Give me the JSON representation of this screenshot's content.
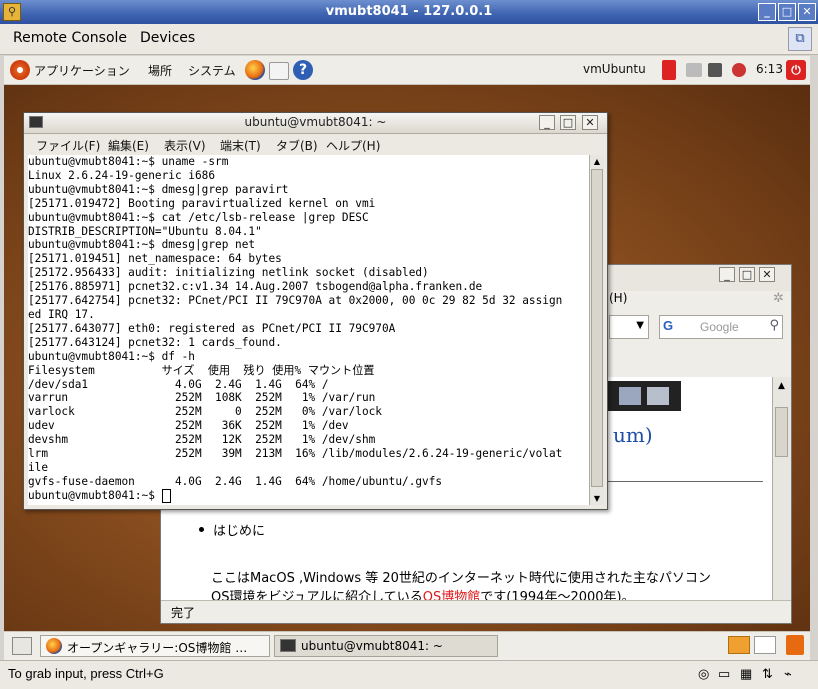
{
  "window": {
    "title": "vmubt8041 - 127.0.0.1"
  },
  "menubar": {
    "items": [
      "Remote Console",
      "Devices"
    ]
  },
  "gnome_panel": {
    "menus": [
      "アプリケーション",
      "場所",
      "システム"
    ],
    "host_label": "vmUbuntu",
    "clock": "6:13"
  },
  "terminal": {
    "title": "ubuntu@vmubt8041: ~",
    "menus": [
      "ファイル(F)",
      "編集(E)",
      "表示(V)",
      "端末(T)",
      "タブ(B)",
      "ヘルプ(H)"
    ],
    "lines": [
      "ubuntu@vmubt8041:~$ uname -srm",
      "Linux 2.6.24-19-generic i686",
      "ubuntu@vmubt8041:~$ dmesg|grep paravirt",
      "[25171.019472] Booting paravirtualized kernel on vmi",
      "ubuntu@vmubt8041:~$ cat /etc/lsb-release |grep DESC",
      "DISTRIB_DESCRIPTION=\"Ubuntu 8.04.1\"",
      "ubuntu@vmubt8041:~$ dmesg|grep net",
      "[25171.019451] net_namespace: 64 bytes",
      "[25172.956433] audit: initializing netlink socket (disabled)",
      "[25176.885971] pcnet32.c:v1.34 14.Aug.2007 tsbogend@alpha.franken.de",
      "[25177.642754] pcnet32: PCnet/PCI II 79C970A at 0x2000, 00 0c 29 82 5d 32 assign",
      "ed IRQ 17.",
      "[25177.643077] eth0: registered as PCnet/PCI II 79C970A",
      "[25177.643124] pcnet32: 1 cards_found.",
      "ubuntu@vmubt8041:~$ df -h",
      "Filesystem          サイズ  使用  残り 使用% マウント位置",
      "/dev/sda1             4.0G  2.4G  1.4G  64% /",
      "varrun                252M  108K  252M   1% /var/run",
      "varlock               252M     0  252M   0% /var/lock",
      "udev                  252M   36K  252M   1% /dev",
      "devshm                252M   12K  252M   1% /dev/shm",
      "lrm                   252M   39M  213M  16% /lib/modules/2.6.24-19-generic/volat",
      "ile",
      "gvfs-fuse-daemon      4.0G  2.4G  1.4G  64% /home/ubuntu/.gvfs"
    ],
    "prompt": "ubuntu@vmubt8041:~$ "
  },
  "browser": {
    "menu_fragment": "(H)",
    "search_placeholder": "Google",
    "heading_fragment": "um)",
    "bullet": "はじめに",
    "para_line1": "ここはMacOS ,Windows 等 20世紀のインターネット時代に使用された主なパソコン",
    "para_line2_pre": "OS環境をビジュアルに紹介している",
    "para_line2_link": "OS博物館",
    "para_line2_post": "です(1994年〜2000年)。",
    "status": "完了"
  },
  "taskbar": {
    "tasks": [
      "オープンギャラリー:OS博物館 …",
      "ubuntu@vmubt8041: ~"
    ]
  },
  "vm_status": {
    "text": "To grab input, press Ctrl+G"
  },
  "colors": {
    "link": "#e0191b",
    "title_bar": "#3e63b0",
    "heading_blue": "#1f4ea8"
  }
}
